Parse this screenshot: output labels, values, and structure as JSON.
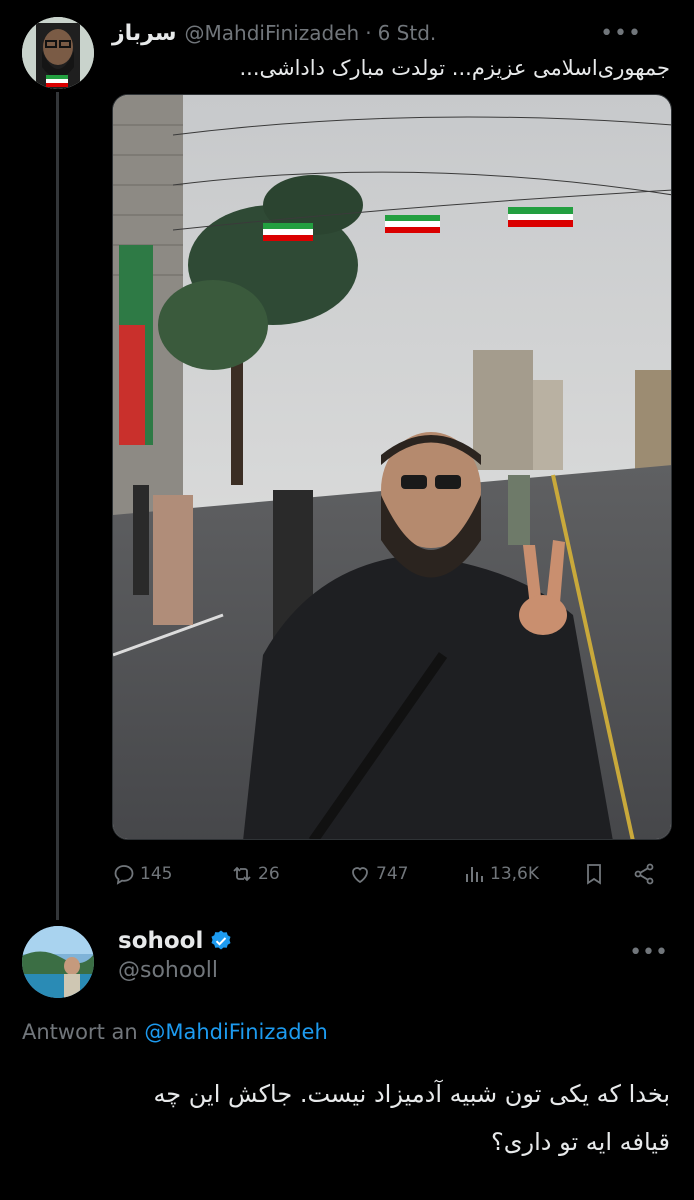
{
  "tweet": {
    "author_name": "سرباز",
    "handle": "@MahdiFinizadeh",
    "separator": "·",
    "time": "6 Std.",
    "more": "•••",
    "text": "جمهوری‌اسلامی عزیزم... تولدت مبارک داداشی...",
    "stats": {
      "replies": "145",
      "reposts": "26",
      "likes": "747",
      "views": "13,6K"
    }
  },
  "reply": {
    "author_name": "sohool",
    "handle": "@sohooll",
    "more": "•••",
    "replying_label": "Antwort an",
    "replying_mention": "@MahdiFinizadeh",
    "text_line1": "بخدا که یکی تون شبیه آدمیزاد نیست. جاکش این چه",
    "text_line2": "قیافه ایه تو داری؟"
  },
  "colors": {
    "background": "#000000",
    "text": "#e7e9ea",
    "muted": "#71767b",
    "accent": "#1d9bf0"
  }
}
